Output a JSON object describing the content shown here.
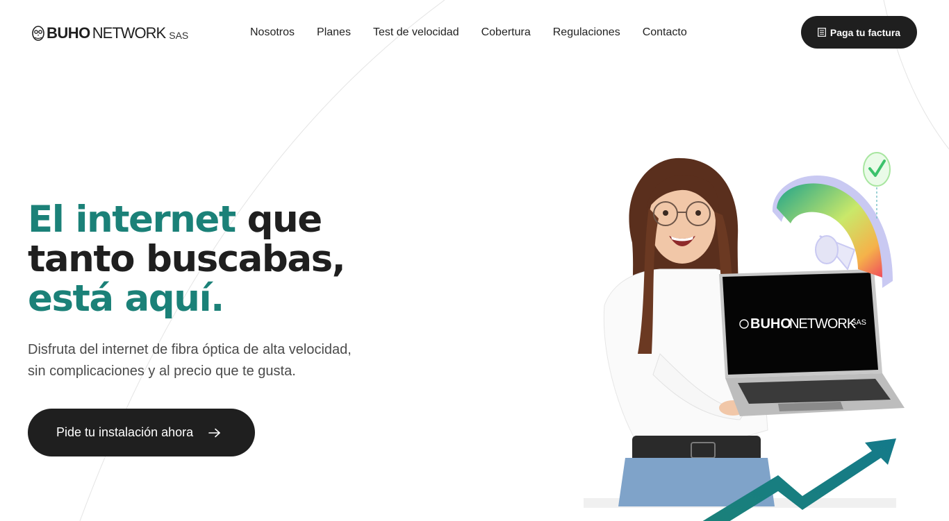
{
  "brand": {
    "name_bold": "BUHO",
    "name_light": "NETWORK",
    "suffix": "SAS",
    "owl_icon": "owl-logo-icon"
  },
  "nav": {
    "items": [
      {
        "label": "Nosotros"
      },
      {
        "label": "Planes"
      },
      {
        "label": "Test de velocidad"
      },
      {
        "label": "Cobertura"
      },
      {
        "label": "Regulaciones"
      },
      {
        "label": "Contacto"
      }
    ]
  },
  "header": {
    "pay_button": {
      "label": "Paga tu factura",
      "icon": "invoice-icon"
    }
  },
  "hero": {
    "headline": {
      "part1_accent": "El internet",
      "part2": " que tanto buscabas, ",
      "part3_accent": "está aquí."
    },
    "subtitle_line1": "Disfruta del internet de fibra óptica de alta velocidad,",
    "subtitle_line2": "sin complicaciones y al precio que te gusta.",
    "cta": {
      "label": "Pide tu instalación ahora",
      "icon": "arrow-right-icon"
    },
    "laptop_screen_brand": {
      "bold": "BUHO",
      "light": "NETWORK",
      "suffix": "SAS"
    }
  },
  "colors": {
    "accent": "#1b8178",
    "dark": "#1f1f1f",
    "text_muted": "#4a4a4a",
    "background": "#ffffff"
  }
}
